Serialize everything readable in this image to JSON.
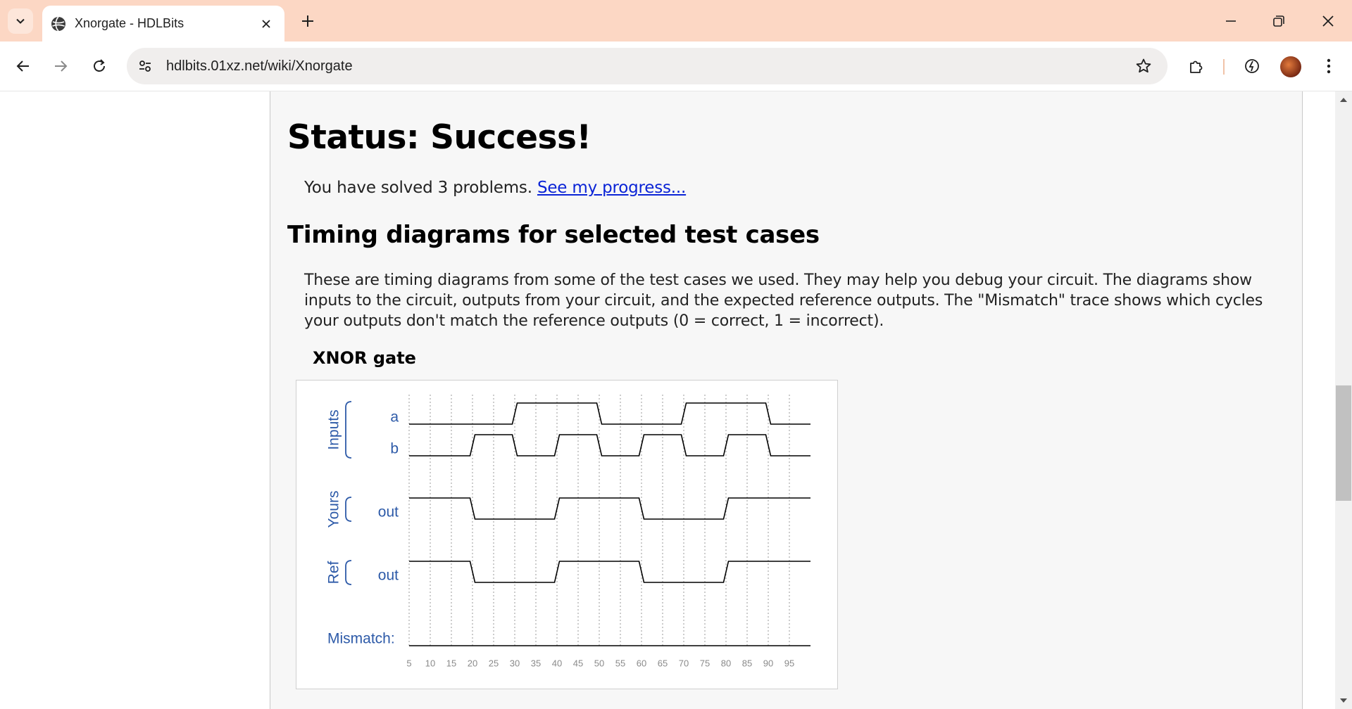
{
  "browser": {
    "tab_title": "Xnorgate - HDLBits",
    "url": "hdlbits.01xz.net/wiki/Xnorgate",
    "icons": {
      "tab_search": "chevron-down-icon",
      "favicon": "globe-icon",
      "tab_close": "close-icon",
      "new_tab": "plus-icon",
      "minimize": "minimize-icon",
      "restore": "restore-icon",
      "window_close": "close-icon",
      "back": "arrow-left-icon",
      "forward": "arrow-right-icon",
      "reload": "reload-icon",
      "site_info": "tune-icon",
      "bookmark": "star-icon",
      "extensions": "puzzle-icon",
      "performance": "gauge-icon",
      "profile": "avatar",
      "menu": "kebab-menu-icon"
    },
    "colors": {
      "tabstrip": "#fcd7c4",
      "omnibox": "#f0eeed"
    }
  },
  "page": {
    "status_heading": "Status: Success!",
    "solved_text": "You have solved 3 problems.",
    "progress_link": "See my progress...",
    "timing_heading": "Timing diagrams for selected test cases",
    "description": "These are timing diagrams from some of the test cases we used. They may help you debug your circuit. The diagrams show inputs to the circuit, outputs from your circuit, and the expected reference outputs. The \"Mismatch\" trace shows which cycles your outputs don't match the reference outputs (0 = correct, 1 = incorrect).",
    "diagram_title": "XNOR gate",
    "colors": {
      "link": "#0b24d6",
      "label_blue": "#2d5aa8",
      "waveform": "#000000"
    }
  },
  "chart_data": {
    "type": "timing-diagram",
    "title": "XNOR gate",
    "groups": [
      {
        "label": "Inputs",
        "signals": [
          "a",
          "b"
        ]
      },
      {
        "label": "Yours",
        "signals": [
          "out"
        ]
      },
      {
        "label": "Ref",
        "signals": [
          "out"
        ]
      }
    ],
    "mismatch_label": "Mismatch:",
    "time_ticks": [
      5,
      10,
      15,
      20,
      25,
      30,
      35,
      40,
      45,
      50,
      55,
      60,
      65,
      70,
      75,
      80,
      85,
      90,
      95
    ],
    "time_range": [
      5,
      100
    ],
    "signals": [
      {
        "group": "Inputs",
        "name": "a",
        "transitions": [
          [
            5,
            0
          ],
          [
            30,
            1
          ],
          [
            50,
            0
          ],
          [
            70,
            1
          ],
          [
            90,
            0
          ]
        ]
      },
      {
        "group": "Inputs",
        "name": "b",
        "transitions": [
          [
            5,
            0
          ],
          [
            20,
            1
          ],
          [
            30,
            0
          ],
          [
            40,
            1
          ],
          [
            50,
            0
          ],
          [
            60,
            1
          ],
          [
            70,
            0
          ],
          [
            80,
            1
          ],
          [
            90,
            0
          ]
        ]
      },
      {
        "group": "Yours",
        "name": "out",
        "transitions": [
          [
            5,
            1
          ],
          [
            20,
            0
          ],
          [
            40,
            1
          ],
          [
            60,
            0
          ],
          [
            80,
            1
          ]
        ]
      },
      {
        "group": "Ref",
        "name": "out",
        "transitions": [
          [
            5,
            1
          ],
          [
            20,
            0
          ],
          [
            40,
            1
          ],
          [
            60,
            0
          ],
          [
            80,
            1
          ]
        ]
      },
      {
        "group": "Mismatch",
        "name": "Mismatch:",
        "transitions": [
          [
            5,
            0
          ]
        ]
      }
    ]
  }
}
